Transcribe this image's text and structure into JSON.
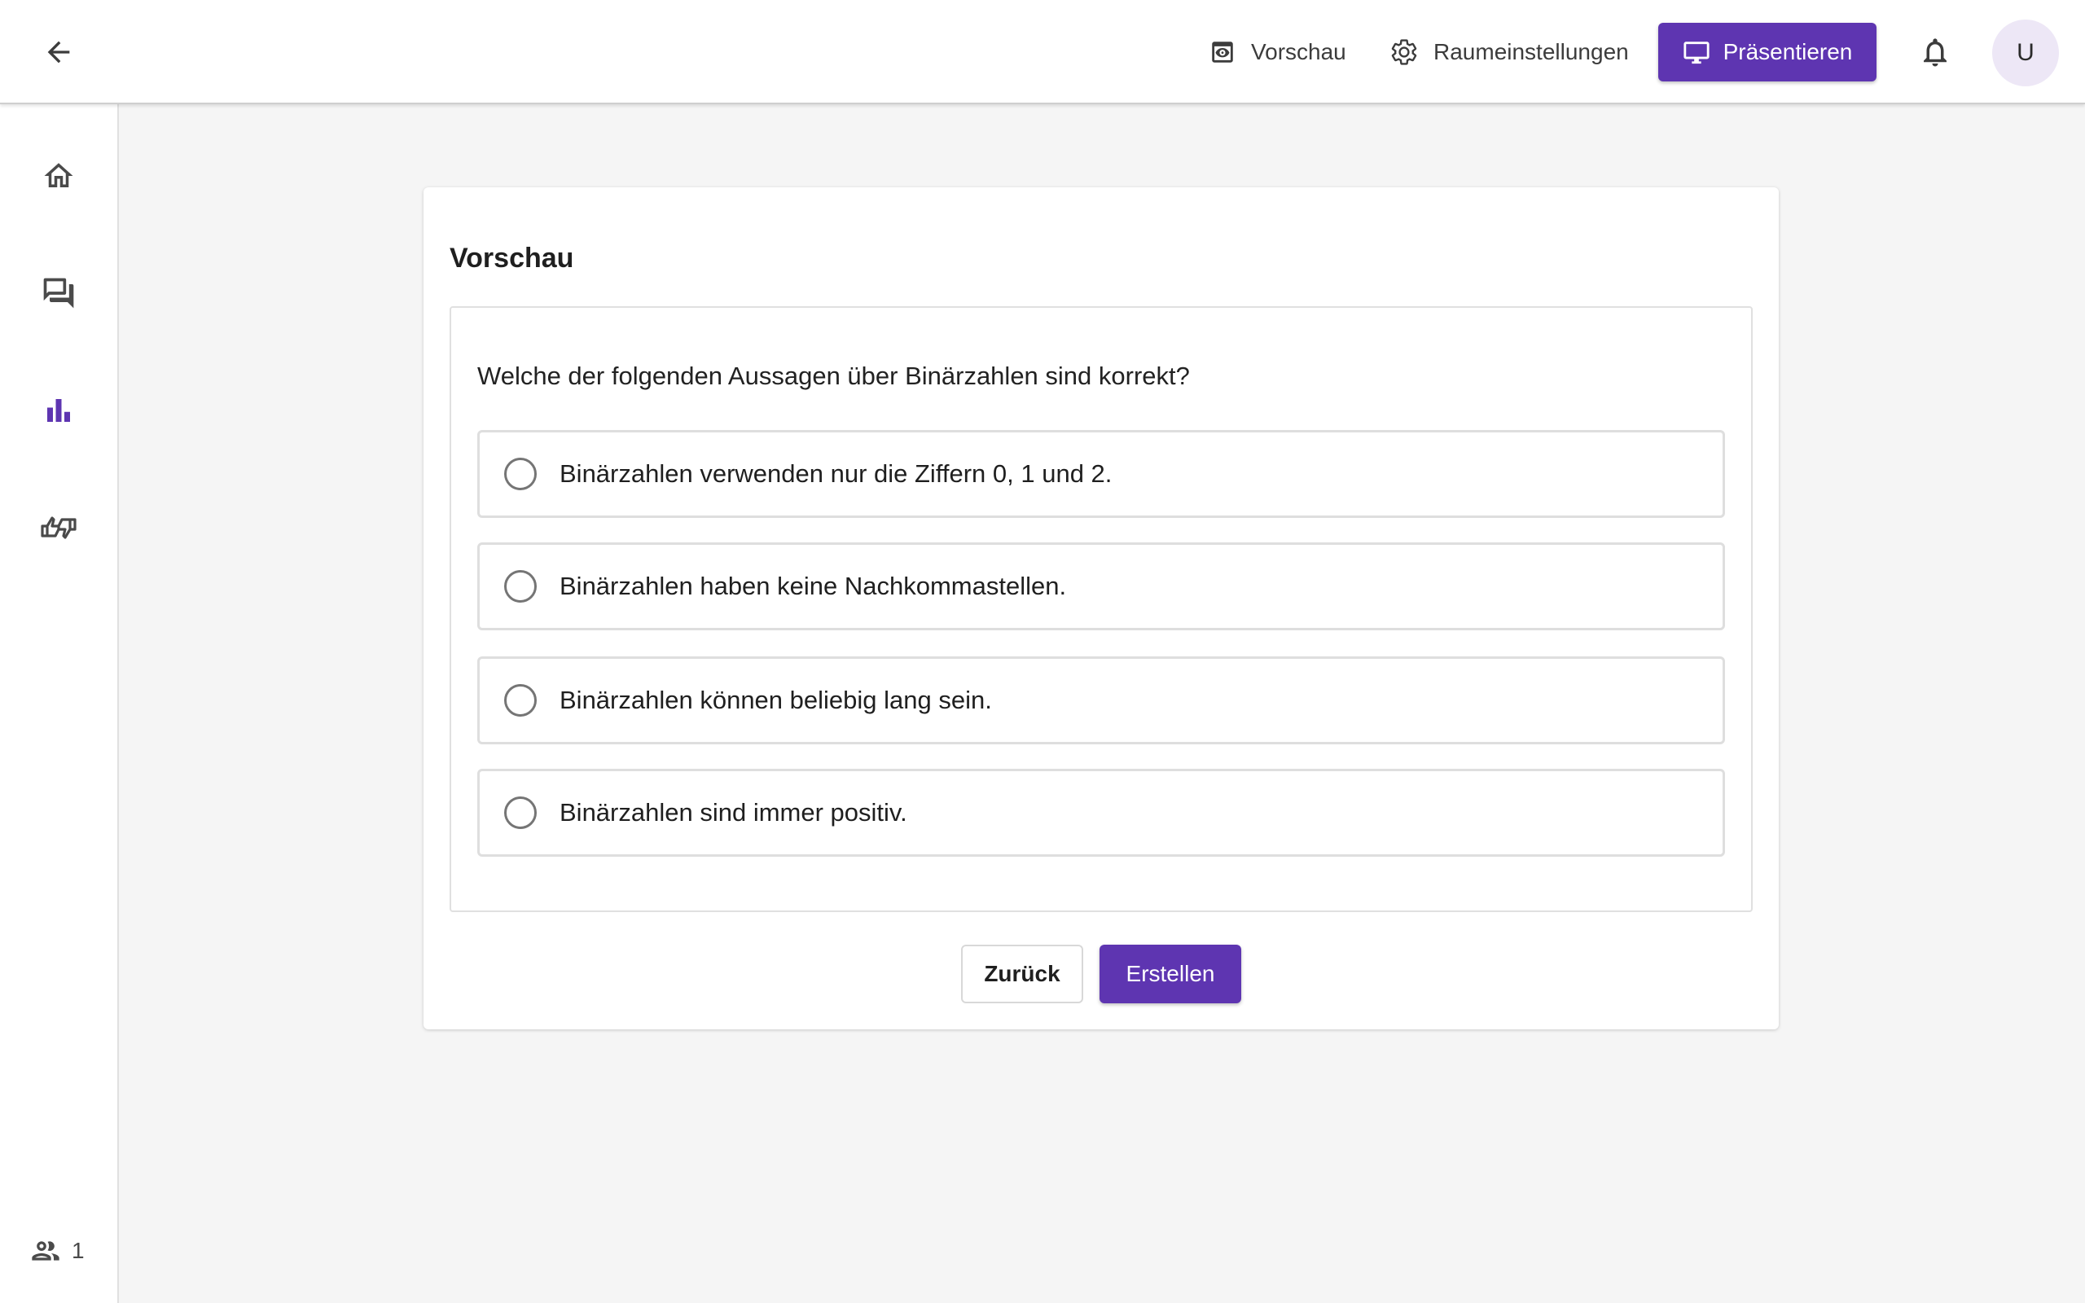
{
  "header": {
    "preview_label": "Vorschau",
    "settings_label": "Raumeinstellungen",
    "present_label": "Präsentieren",
    "avatar_initial": "U",
    "icons": [
      "arrow-left-icon",
      "preview-icon",
      "gear-icon",
      "monitor-icon",
      "bell-icon"
    ]
  },
  "sidebar": {
    "items": [
      {
        "name": "home",
        "icon": "home-icon",
        "active": false
      },
      {
        "name": "questions",
        "icon": "forum-icon",
        "active": false
      },
      {
        "name": "surveys",
        "icon": "bar-chart-icon",
        "active": true
      },
      {
        "name": "feedback",
        "icon": "thumbs-icon",
        "active": false
      }
    ],
    "participant_count": "1"
  },
  "card": {
    "title": "Vorschau",
    "question": "Welche der folgenden Aussagen über Binärzahlen sind korrekt?",
    "options": [
      "Binärzahlen verwenden nur die Ziffern 0, 1 und 2.",
      "Binärzahlen haben keine Nachkommastellen.",
      "Binärzahlen können beliebig lang sein.",
      "Binärzahlen sind immer positiv."
    ],
    "back_label": "Zurück",
    "create_label": "Erstellen"
  },
  "colors": {
    "accent": "#5e35b1",
    "background": "#f5f5f5",
    "avatar_bg": "#ede7f6"
  }
}
